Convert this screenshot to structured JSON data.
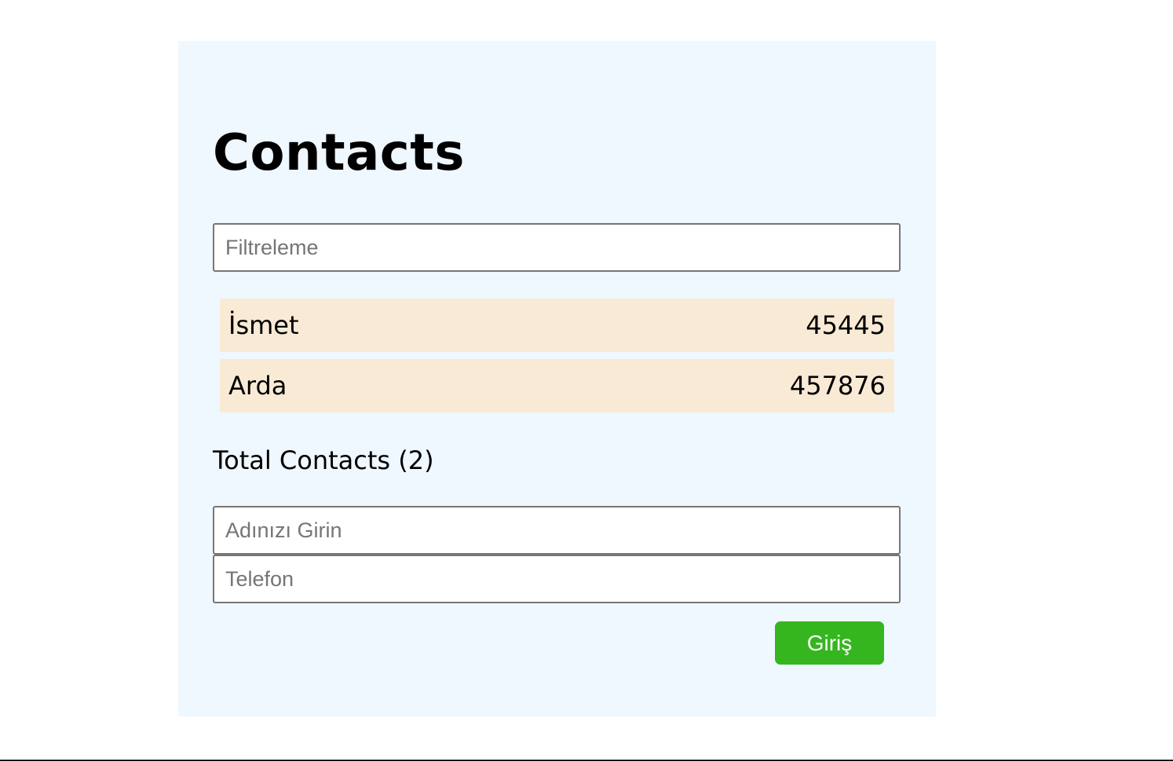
{
  "app": {
    "title": "Contacts"
  },
  "filter": {
    "placeholder": "Filtreleme",
    "value": ""
  },
  "contacts": [
    {
      "name": "İsmet",
      "phone": "45445"
    },
    {
      "name": "Arda",
      "phone": "457876"
    }
  ],
  "summary": {
    "total_label": "Total Contacts (2)"
  },
  "form": {
    "name_placeholder": "Adınızı Girin",
    "phone_placeholder": "Telefon",
    "submit_label": "Giriş"
  },
  "colors": {
    "panel_background": "#eff7ff",
    "row_background": "#f9ead6",
    "button_background": "#35b61f",
    "button_text": "#ffffff"
  }
}
